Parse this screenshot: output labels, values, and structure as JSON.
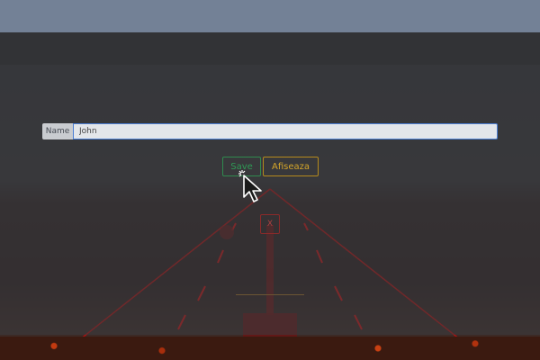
{
  "form": {
    "name_label": "Name",
    "name_value": "John"
  },
  "buttons": {
    "save_label": "Save",
    "afiseaza_label": "Afiseaza",
    "close_label": "X"
  },
  "colors": {
    "topbar": "#738196",
    "save": "#2f9a55",
    "afiseaza": "#d4a52a",
    "close": "#b04040",
    "road_red": "#ff0000",
    "input_border": "#4c7fd4"
  }
}
